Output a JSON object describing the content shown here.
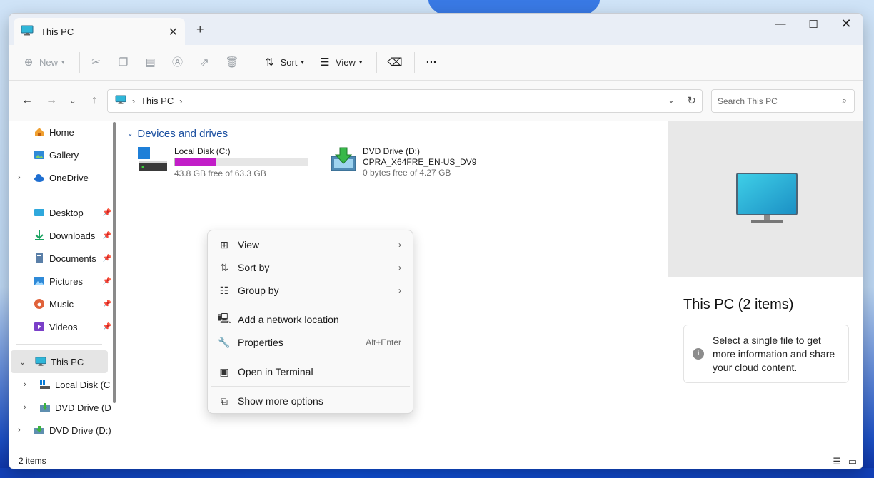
{
  "window": {
    "tab_title": "This PC",
    "controls": {
      "minimize": "—",
      "maximize": "☐",
      "close": "✕"
    }
  },
  "toolbar": {
    "new_label": "New",
    "sort_label": "Sort",
    "view_label": "View",
    "more_label": "···"
  },
  "address": {
    "path_label": "This PC",
    "search_placeholder": "Search This PC"
  },
  "sidebar": {
    "quick": [
      {
        "label": "Home",
        "icon": "home-icon"
      },
      {
        "label": "Gallery",
        "icon": "gallery-icon"
      },
      {
        "label": "OneDrive",
        "icon": "cloud-icon"
      }
    ],
    "pinned": [
      {
        "label": "Desktop",
        "icon": "desktop-folder-icon"
      },
      {
        "label": "Downloads",
        "icon": "download-icon"
      },
      {
        "label": "Documents",
        "icon": "documents-icon"
      },
      {
        "label": "Pictures",
        "icon": "pictures-icon"
      },
      {
        "label": "Music",
        "icon": "music-icon"
      },
      {
        "label": "Videos",
        "icon": "videos-icon"
      }
    ],
    "this_pc": "This PC",
    "children": [
      {
        "label": "Local Disk (C:)"
      },
      {
        "label": "DVD Drive (D:)"
      },
      {
        "label": "DVD Drive (D:) C"
      }
    ]
  },
  "content": {
    "group_title": "Devices and drives",
    "drives": [
      {
        "name": "Local Disk (C:)",
        "free_text": "43.8 GB free of 63.3 GB",
        "used_fraction": 0.31,
        "bar_color": "#c21ec8"
      },
      {
        "name": "DVD Drive (D:)",
        "volume": "CPRA_X64FRE_EN-US_DV9",
        "free_text": "0 bytes free of 4.27 GB"
      }
    ]
  },
  "preview": {
    "title": "This PC (2 items)",
    "info": "Select a single file to get more information and share your cloud content."
  },
  "context_menu": {
    "items": [
      {
        "label": "View",
        "icon": "grid-icon",
        "submenu": true
      },
      {
        "label": "Sort by",
        "icon": "sort-icon",
        "submenu": true
      },
      {
        "label": "Group by",
        "icon": "group-icon",
        "submenu": true
      },
      {
        "label": "Add a network location",
        "icon": "network-icon"
      },
      {
        "label": "Properties",
        "icon": "wrench-icon",
        "shortcut": "Alt+Enter"
      },
      {
        "label": "Open in Terminal",
        "icon": "terminal-icon"
      },
      {
        "label": "Show more options",
        "icon": "more-options-icon"
      }
    ]
  },
  "status": {
    "count": "2 items"
  }
}
